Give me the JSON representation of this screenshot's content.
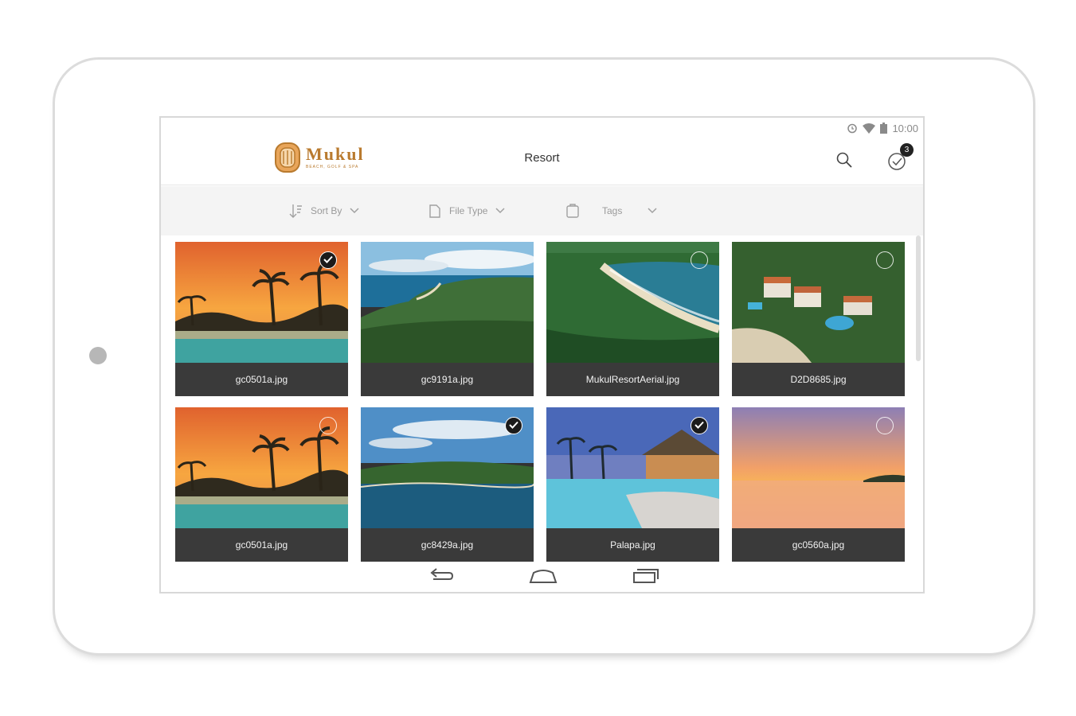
{
  "status": {
    "time": "10:00"
  },
  "app": {
    "logo_word": "Mukul",
    "logo_sub": "BEACH, GOLF & SPA",
    "title": "Resort",
    "selected_count": "3"
  },
  "filters": [
    {
      "label": "Sort By",
      "icon": "sort-icon"
    },
    {
      "label": "File Type",
      "icon": "file-icon"
    },
    {
      "label": "Tags",
      "icon": "tag-icon"
    }
  ],
  "images": [
    {
      "name": "gc0501a.jpg",
      "selected": true,
      "scene": "sunset-pool"
    },
    {
      "name": "gc9191a.jpg",
      "selected": false,
      "scene": "coast-aerial"
    },
    {
      "name": "MukulResortAerial.jpg",
      "selected": false,
      "scene": "beach-aerial"
    },
    {
      "name": "D2D8685.jpg",
      "selected": false,
      "scene": "villa-aerial"
    },
    {
      "name": "gc0501a.jpg",
      "selected": false,
      "scene": "sunset-pool"
    },
    {
      "name": "gc8429a.jpg",
      "selected": true,
      "scene": "bay"
    },
    {
      "name": "Palapa.jpg",
      "selected": true,
      "scene": "palapa-pool"
    },
    {
      "name": "gc0560a.jpg",
      "selected": false,
      "scene": "sea-sunset"
    }
  ],
  "colors": {
    "brand": "#b97a2e",
    "caption_bg": "#3a3a3a",
    "filter_bg": "#f4f4f4"
  }
}
